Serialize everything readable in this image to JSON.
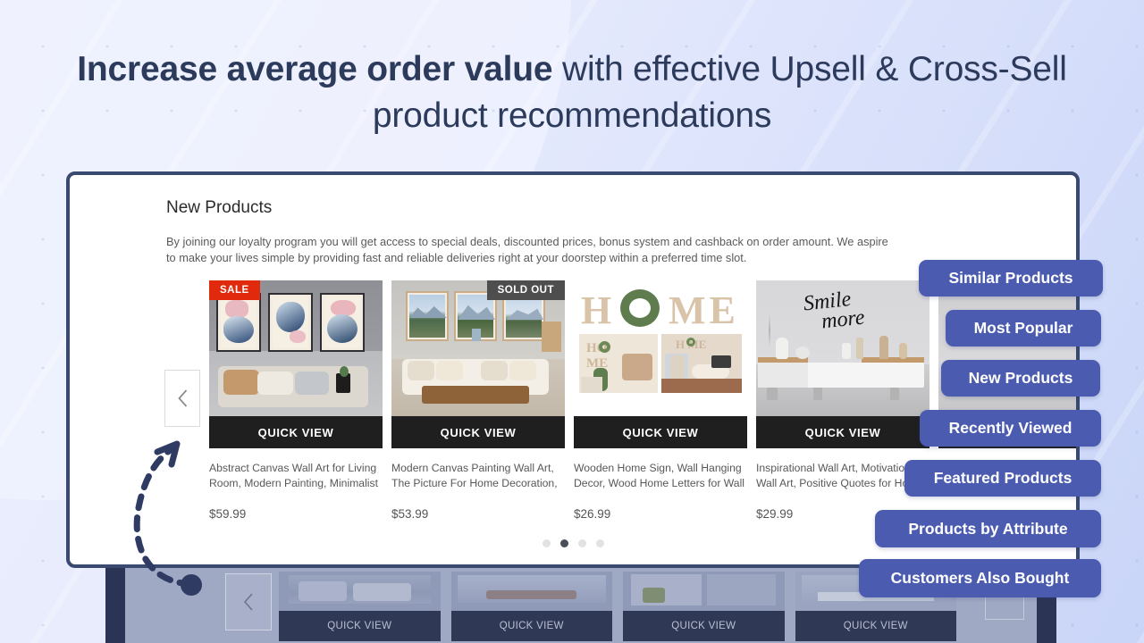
{
  "headline": {
    "bold": "Increase average order value",
    "rest": " with effective Upsell & Cross-Sell product recommendations"
  },
  "colors": {
    "accent_blue": "#4b5cb0",
    "panel_border": "#39496f",
    "sale_badge": "#e1290d",
    "sold_out_badge": "#4e4e4e",
    "quickview_bg": "#1f1f1f",
    "heading_text": "#2c3a5c"
  },
  "panel": {
    "section_title": "New Products",
    "section_description": "By joining our loyalty program you will get access to special deals, discounted prices, bonus system and cashback on order amount. We aspire to make your lives simple by providing fast and reliable deliveries right at your doorstep within a preferred time slot.",
    "prev_arrow_icon": "chevron-left-icon",
    "quick_view_label": "QUICK VIEW",
    "carousel": {
      "dot_count": 4,
      "active_dot_index": 1
    },
    "products": [
      {
        "badge": "SALE",
        "badge_type": "sale",
        "title": "Abstract Canvas Wall Art for Living Room, Modern Painting, Minimalist",
        "price": "$59.99"
      },
      {
        "badge": "SOLD OUT",
        "badge_type": "sold",
        "title": "Modern Canvas Painting Wall Art, The Picture For Home Decoration,",
        "price": "$53.99"
      },
      {
        "badge": "",
        "badge_type": "none",
        "title": "Wooden Home Sign, Wall Hanging Decor, Wood Home Letters for Wall",
        "price": "$26.99"
      },
      {
        "badge": "",
        "badge_type": "none",
        "title": "Inspirational Wall Art, Motivational Wall Art, Positive Quotes for Home",
        "price": "$29.99"
      }
    ]
  },
  "feature_pills": [
    {
      "label": "Similar Products"
    },
    {
      "label": "Most Popular"
    },
    {
      "label": "New Products"
    },
    {
      "label": "Recently Viewed"
    },
    {
      "label": "Featured Products"
    },
    {
      "label": "Products by Attribute"
    },
    {
      "label": "Customers Also Bought"
    }
  ],
  "bottom_preview": {
    "quick_view_label": "QUICK VIEW",
    "prev_arrow_icon": "chevron-left-icon",
    "card_count": 4
  }
}
